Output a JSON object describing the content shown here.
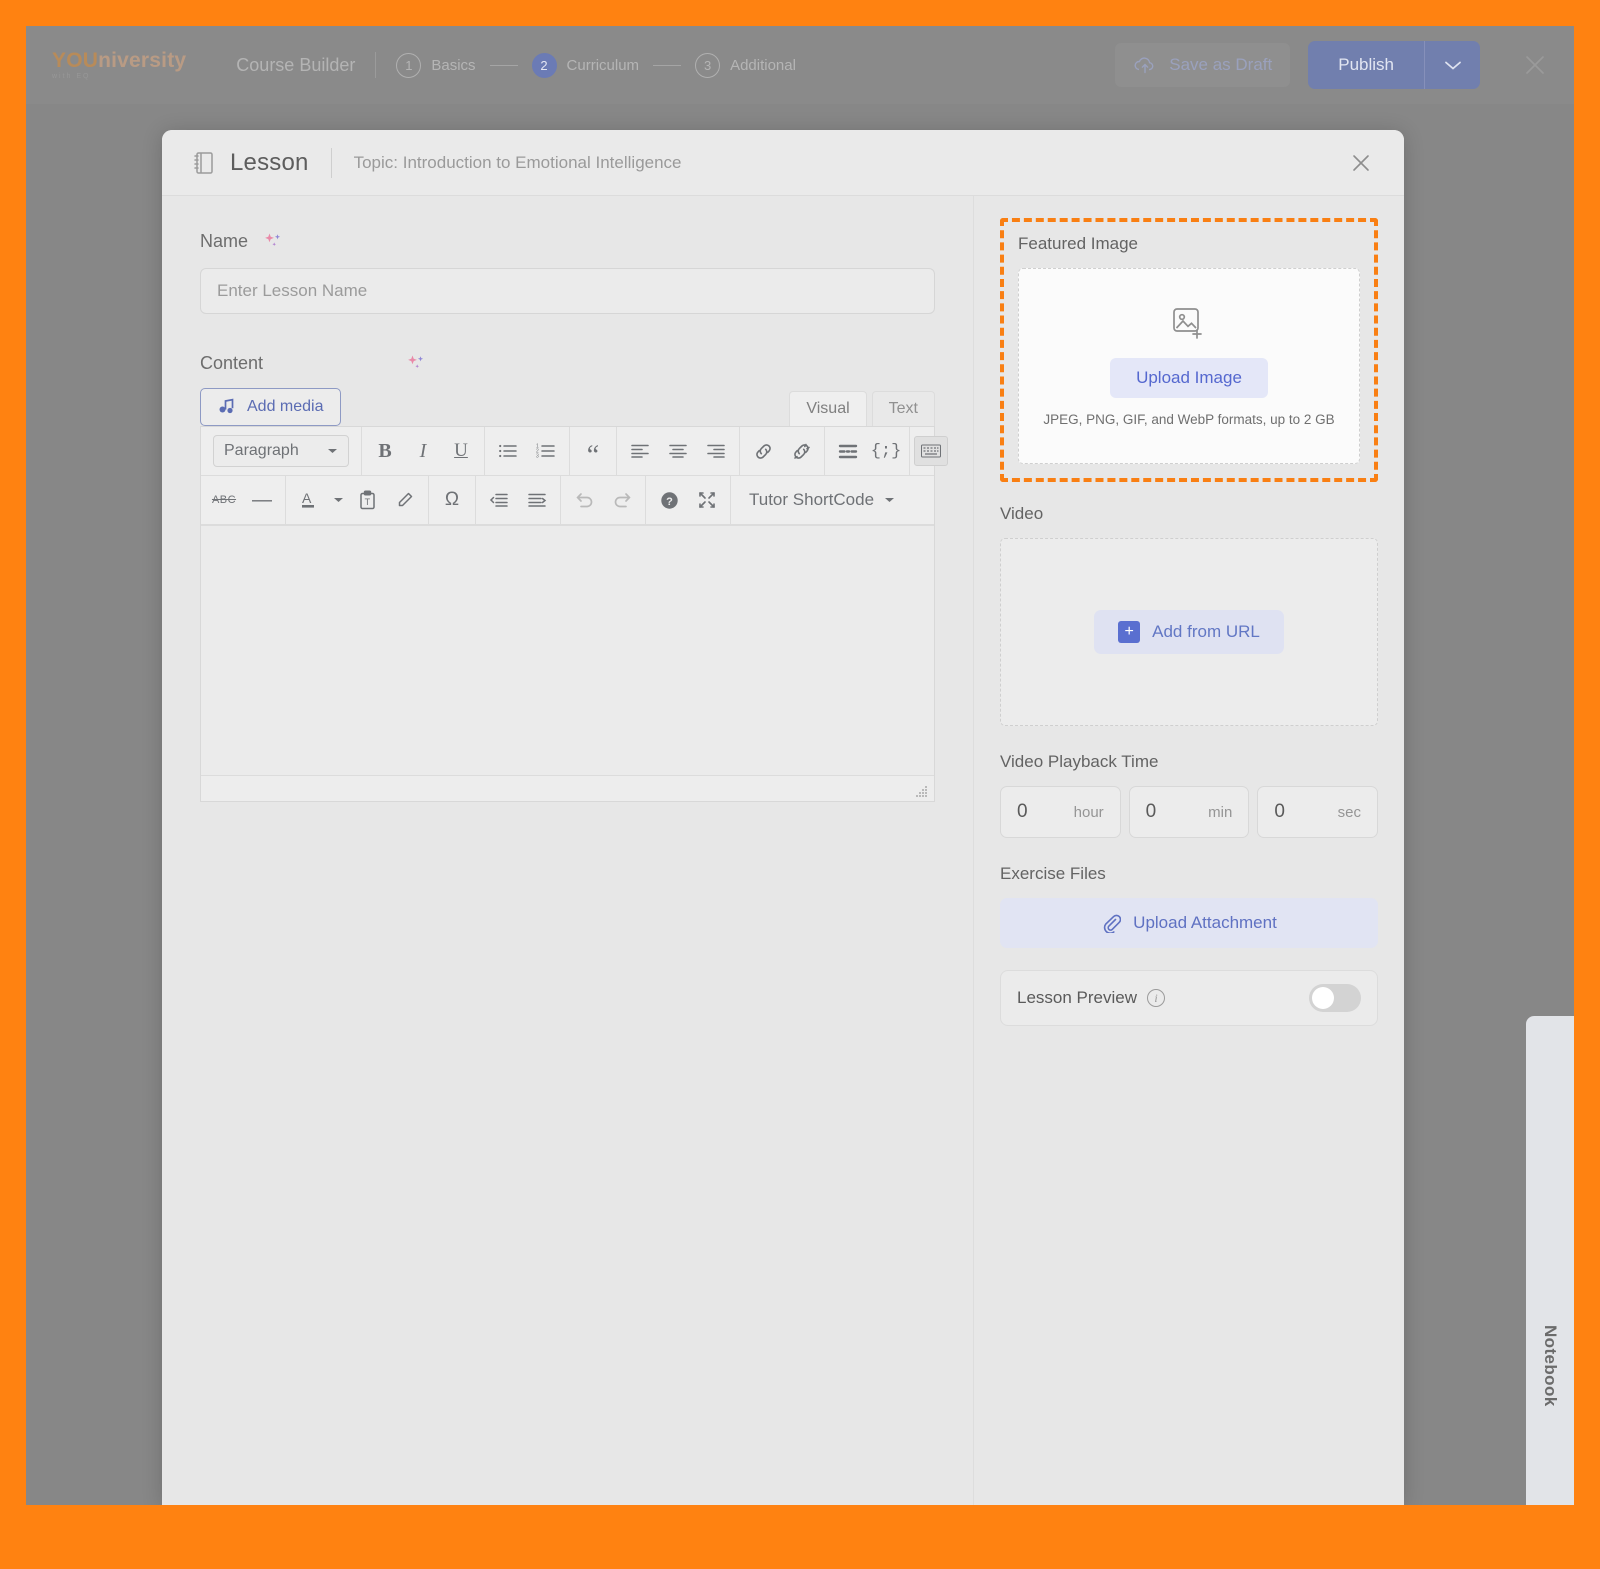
{
  "app": {
    "brand_primary": "YOU",
    "brand_secondary": "niversity",
    "brand_tagline": "with EQ",
    "builder_title": "Course Builder",
    "steps": [
      {
        "num": "1",
        "label": "Basics",
        "active": false
      },
      {
        "num": "2",
        "label": "Curriculum",
        "active": true
      },
      {
        "num": "3",
        "label": "Additional",
        "active": false
      }
    ],
    "save_draft_label": "Save as Draft",
    "publish_label": "Publish",
    "close_icon": "close-icon"
  },
  "modal": {
    "title": "Lesson",
    "topic": "Topic: Introduction to Emotional Intelligence",
    "close_icon": "close-icon"
  },
  "form": {
    "name_label": "Name",
    "name_value": "",
    "name_placeholder": "Enter Lesson Name",
    "content_label": "Content",
    "add_media_label": "Add media",
    "tabs": [
      {
        "label": "Visual",
        "active": true
      },
      {
        "label": "Text",
        "active": false
      }
    ],
    "paragraph_select": "Paragraph",
    "shortcode_select": "Tutor ShortCode",
    "toolbar_row1": [
      {
        "name": "bold-icon",
        "glyph": "B"
      },
      {
        "name": "italic-icon",
        "glyph": "I"
      },
      {
        "name": "underline-icon",
        "glyph": "U"
      },
      {
        "name": "bulleted-list-icon",
        "glyph": ""
      },
      {
        "name": "numbered-list-icon",
        "glyph": ""
      },
      {
        "name": "blockquote-icon",
        "glyph": "“"
      },
      {
        "name": "align-left-icon",
        "glyph": ""
      },
      {
        "name": "align-center-icon",
        "glyph": ""
      },
      {
        "name": "align-right-icon",
        "glyph": ""
      },
      {
        "name": "insert-link-icon",
        "glyph": ""
      },
      {
        "name": "unlink-icon",
        "glyph": ""
      },
      {
        "name": "read-more-icon",
        "glyph": ""
      },
      {
        "name": "code-icon",
        "glyph": "{;}"
      },
      {
        "name": "toolbar-toggle-icon",
        "glyph": ""
      }
    ],
    "toolbar_row2": [
      {
        "name": "strikethrough-icon",
        "glyph": "ABC"
      },
      {
        "name": "horizontal-rule-icon",
        "glyph": "—"
      },
      {
        "name": "text-color-icon",
        "glyph": "A"
      },
      {
        "name": "paste-as-text-icon",
        "glyph": ""
      },
      {
        "name": "clear-formatting-icon",
        "glyph": ""
      },
      {
        "name": "special-character-icon",
        "glyph": "Ω"
      },
      {
        "name": "outdent-icon",
        "glyph": ""
      },
      {
        "name": "indent-icon",
        "glyph": ""
      },
      {
        "name": "undo-icon",
        "glyph": ""
      },
      {
        "name": "redo-icon",
        "glyph": ""
      },
      {
        "name": "keyboard-shortcuts-icon",
        "glyph": "?"
      },
      {
        "name": "fullscreen-icon",
        "glyph": ""
      }
    ],
    "editor_body": ""
  },
  "sidebar": {
    "featured_image": {
      "label": "Featured Image",
      "icon": "image-add-icon",
      "upload_label": "Upload Image",
      "hint": "JPEG, PNG, GIF, and WebP formats, up to 2 GB",
      "highlight_color": "#F97F13",
      "highlighted": true
    },
    "video": {
      "label": "Video",
      "add_url_label": "Add from URL"
    },
    "playback": {
      "label": "Video Playback Time",
      "fields": [
        {
          "value": "0",
          "unit": "hour"
        },
        {
          "value": "0",
          "unit": "min"
        },
        {
          "value": "0",
          "unit": "sec"
        }
      ]
    },
    "exercise": {
      "label": "Exercise Files",
      "upload_label": "Upload Attachment",
      "icon": "paperclip-icon"
    },
    "preview": {
      "label": "Lesson Preview",
      "info_icon": "info-icon",
      "enabled": false
    }
  },
  "notebook": {
    "label": "Notebook"
  },
  "colors": {
    "accent_orange": "#FF8211",
    "highlight_orange": "#F97F13",
    "primary_blue": "#5568CF",
    "step_active": "#6B7BB5"
  }
}
